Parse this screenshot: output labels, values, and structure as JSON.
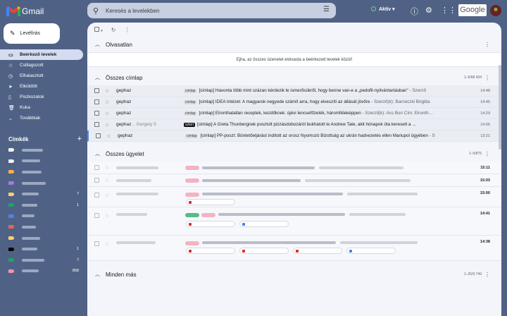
{
  "app": {
    "title": "Gmail"
  },
  "search": {
    "placeholder": "Keresés a levelekben"
  },
  "status": {
    "label": "Aktív"
  },
  "account": {
    "brand": "Google"
  },
  "compose": {
    "label": "Levélírás"
  },
  "nav": [
    {
      "label": "Beérkező levelek",
      "icon": "inbox-icon",
      "active": true
    },
    {
      "label": "Csillagozott",
      "icon": "star-icon"
    },
    {
      "label": "Elhalasztott",
      "icon": "clock-icon"
    },
    {
      "label": "Elküldött",
      "icon": "send-icon"
    },
    {
      "label": "Piszkozatok",
      "icon": "draft-icon"
    },
    {
      "label": "Kuka",
      "icon": "trash-icon"
    },
    {
      "label": "Továbbiak",
      "icon": "chevron-down-icon"
    }
  ],
  "labels": {
    "title": "Címkék",
    "items": [
      {
        "color": "#f2f2f2",
        "count": ""
      },
      {
        "color": "#f2f2f2",
        "count": ""
      },
      {
        "color": "#ffad47",
        "count": ""
      },
      {
        "color": "#a479e2",
        "count": ""
      },
      {
        "color": "#fad165",
        "count": "7"
      },
      {
        "color": "#16a765",
        "count": "1"
      },
      {
        "color": "#4a86e8",
        "count": ""
      },
      {
        "color": "#e66550",
        "count": ""
      },
      {
        "color": "#fad165",
        "count": ""
      },
      {
        "color": "#000000",
        "count": "1"
      },
      {
        "color": "#16a765",
        "count": "7"
      },
      {
        "color": "#f691b3",
        "count": "858"
      }
    ]
  },
  "sections": {
    "unread": {
      "title": "Olvasatlan",
      "empty": "Ejha, az összes üzenetet elolvasta a beérkezett levelek közül!"
    },
    "cimlap": {
      "title": "Összes címlap",
      "pager": "1–5/68 434",
      "rows": [
        {
          "sender": "gephaz",
          "sender_extra": "",
          "chip": "cimlap",
          "subject": "[cimlap] Havonta több mint százan kérdezik le ismerősükről, hogy benne van-e a „pedofil-nyilvántartásban\"",
          "snippet": " - Szerző",
          "date": "14:48"
        },
        {
          "sender": "gephaz",
          "sender_extra": "",
          "chip": "cimlap",
          "subject": "[cimlap] IDEA Intézet: A magyarok negyede számít arra, hogy elveszíti az állását jövőre",
          "snippet": " - Szerző(k): Barnóczki Brigitta",
          "date": "14:45"
        },
        {
          "sender": "gephaz",
          "sender_extra": "",
          "chip": "cimlap",
          "subject": "[cimlap] Elronthatatlan receptek, kezdőknek: újévi lencsefőzelék, háromféleképpen",
          "snippet": " - Szerző(k): Acs Bori Cím: Elronth…",
          "date": "14:29"
        },
        {
          "sender": "gephaz",
          "sender_extra": " .. Gergely 5",
          "chip": "sztori",
          "subject": "[cimlap] A Greta Thunbergnek posztolt pizzásdobozáról bukhatott le Andrew Tate, akit hónapok óta keresett a …",
          "snippet": "",
          "date": "14:05"
        },
        {
          "sender": "gephaz",
          "sender_extra": "",
          "chip": "cimlap",
          "subject": "[cimlap] PP-poszt: Büntetőeljárást indított az orosz Nyomozó Bizottság az ukrán hadvezetés ellen Mariupol ügyében",
          "snippet": " - S",
          "date": "13:21"
        }
      ]
    },
    "ugyelet": {
      "title": "Összes ügyelet",
      "pager": "1–5/875",
      "dates": [
        "15:11",
        "15:03",
        "15:00",
        "14:41",
        "14:38"
      ]
    },
    "more": {
      "title": "Minden más",
      "pager": "1–25/9 749"
    }
  }
}
